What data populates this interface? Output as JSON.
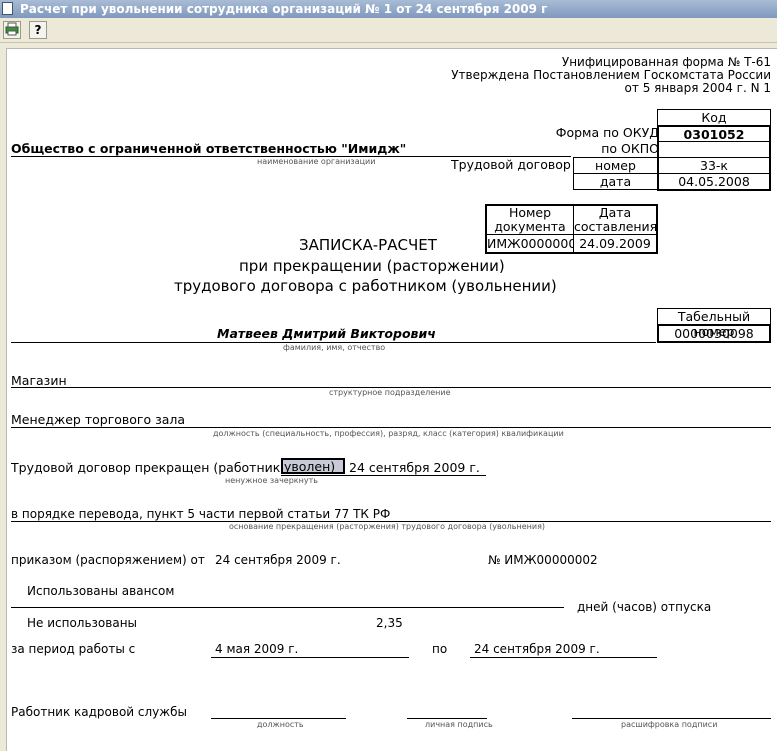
{
  "window": {
    "title": "Расчет при увольнении сотрудника организаций № 1 от 24 сентября 2009 г"
  },
  "toolbar": {
    "print_icon": "printer-icon",
    "help_label": "?"
  },
  "header": {
    "form_line1": "Унифицированная форма № Т-61",
    "form_line2": "Утверждена Постановлением Госкомстата России",
    "form_line3": "от 5 января 2004 г. N 1"
  },
  "codes": {
    "kod_label": "Код",
    "okud_label": "Форма по ОКУД",
    "okud_value": "0301052",
    "okpo_label": "по ОКПО",
    "okpo_value": "",
    "contract_label": "Трудовой договор",
    "number_label": "номер",
    "number_value": "33-к",
    "date_label": "дата",
    "date_value": "04.05.2008"
  },
  "organization": {
    "name": "Общество с ограниченной ответственностью \"Имидж\"",
    "caption": "наименование организации"
  },
  "doc": {
    "number_header": "Номер документа",
    "date_header": "Дата составления",
    "number_value": "ИМЖ0000000",
    "date_value": "24.09.2009"
  },
  "title": {
    "line1": "ЗАПИСКА-РАСЧЕТ",
    "line2": "при прекращении (расторжении)",
    "line3": "трудового договора с работником (увольнении)"
  },
  "employee": {
    "tab_header": "Табельный номер",
    "tab_value": "0000030098",
    "name": "Матвеев Дмитрий Викторович",
    "name_caption": "фамилия, имя, отчество",
    "department": "Магазин",
    "department_caption": "структурное подразделение",
    "position": "Менеджер торгового зала",
    "position_caption": "должность (специальность, профессия), разряд, класс (категория) квалификации"
  },
  "termination": {
    "prefix": "Трудовой договор прекращен (работник",
    "choice": "уволен)",
    "date": "24 сентября 2009 г.",
    "choice_caption": "ненужное зачеркнуть",
    "reason": "в порядке перевода, пункт 5 части первой статьи 77 ТК РФ",
    "reason_caption": "основание прекращения (расторжения) трудового договора (увольнения)",
    "order_label": "приказом (распоряжением) от",
    "order_date": "24 сентября 2009 г.",
    "order_number": "№ ИМЖ00000002"
  },
  "vacation": {
    "used_label": "Использованы авансом",
    "unused_label": "Не использованы",
    "unused_value": "2,35",
    "days_label": "дней (часов) отпуска",
    "period_label": "за период работы с",
    "period_from": "4 мая 2009 г.",
    "period_to_label": "по",
    "period_to": "24 сентября 2009 г."
  },
  "signature": {
    "label": "Работник кадровой службы",
    "position_caption": "должность",
    "sign_caption": "личная подпись",
    "decode_caption": "расшифровка подписи"
  }
}
